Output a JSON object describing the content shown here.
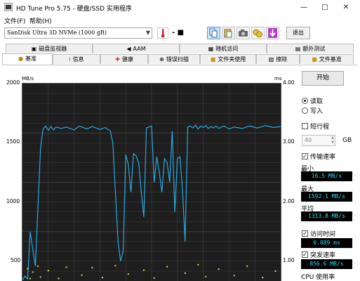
{
  "window": {
    "title": "HD Tune Pro 5.75 - 硬盘/SSD 实用程序",
    "minimize": "—",
    "maximize": "□",
    "close": "✕"
  },
  "menu": [
    "文件(F)",
    "帮助(H)"
  ],
  "toolbar": {
    "drive": "SanDisk Ultra 3D NVMe (1000 gB)",
    "temperature": "- ■",
    "exit_label": "退出",
    "icons": [
      "thermometer-icon",
      "copy-icon",
      "paste-icon",
      "camera-icon",
      "coins-icon",
      "download-icon"
    ]
  },
  "tabs_top": [
    {
      "label": "磁盘监视器",
      "icon": "monitor-icon"
    },
    {
      "label": "AAM",
      "icon": "speaker-icon"
    },
    {
      "label": "随机访问",
      "icon": "random-icon"
    },
    {
      "label": "额外测试",
      "icon": "extra-icon"
    }
  ],
  "tabs_bottom": [
    {
      "label": "基准",
      "icon": "benchmark-icon",
      "selected": true
    },
    {
      "label": "信息",
      "icon": "info-icon"
    },
    {
      "label": "健康",
      "icon": "health-icon"
    },
    {
      "label": "错误扫描",
      "icon": "scan-icon"
    },
    {
      "label": "文件夹使用",
      "icon": "folder-icon"
    },
    {
      "label": "擦除",
      "icon": "erase-icon"
    },
    {
      "label": "文件基准",
      "icon": "file-benchmark-icon"
    }
  ],
  "benchmark": {
    "start_label": "开始",
    "read_label": "读取",
    "write_label": "写入",
    "mode": "read",
    "short_stroke_label": "短行程",
    "short_stroke_checked": false,
    "short_stroke_value": "40",
    "short_stroke_unit": "GB",
    "transfer_rate_label": "传输速率",
    "transfer_rate_checked": true,
    "min_label": "最小",
    "min_value": "16.5 MB/s",
    "max_label": "最大",
    "max_value": "1592.1 MB/s",
    "avg_label": "平均",
    "avg_value": "1313.8 MB/s",
    "access_time_label": "访问时间",
    "access_time_checked": true,
    "access_time_value": "0.089 ms",
    "burst_label": "突发速率",
    "burst_checked": true,
    "burst_value": "856.6 MB/s",
    "cpu_label": "CPU 使用率"
  },
  "chart_data": {
    "type": "line",
    "y_left_unit": "MB/s",
    "y_right_unit": "ms",
    "ylim": [
      0,
      2000
    ],
    "y2lim": [
      0,
      4.0
    ],
    "yticks_left": [
      "2000",
      "1500",
      "1000",
      "500"
    ],
    "yticks_right": [
      "4.00",
      "3.00",
      "2.00",
      "1.00"
    ],
    "grid": true,
    "x": [
      0,
      1,
      2,
      3,
      5,
      7,
      8,
      9,
      10,
      11,
      12,
      13,
      15,
      17,
      20,
      22,
      25,
      27,
      30,
      32,
      34,
      35,
      36,
      37,
      38,
      39,
      40,
      41,
      42,
      43,
      44,
      45,
      46,
      47,
      48,
      49,
      50,
      51,
      52,
      53,
      54,
      55,
      56,
      57,
      58,
      59,
      60,
      61,
      62,
      63,
      64,
      65,
      66,
      67,
      68,
      69,
      70,
      71,
      72,
      73,
      74,
      75,
      76,
      77,
      78,
      80,
      82,
      85,
      88,
      91,
      94,
      97,
      100
    ],
    "y": [
      10,
      50,
      20,
      500,
      150,
      1350,
      1540,
      1570,
      1525,
      1565,
      1530,
      1560,
      1545,
      1560,
      1530,
      1570,
      1540,
      1565,
      1535,
      1555,
      1520,
      1400,
      900,
      400,
      200,
      300,
      1280,
      1180,
      900,
      1290,
      1270,
      1200,
      900,
      650,
      1550,
      1560,
      1570,
      1000,
      1260,
      1100,
      900,
      1240,
      1200,
      1000,
      1520,
      700,
      1240,
      1260,
      900,
      400,
      1560,
      1570,
      1550,
      1580,
      1540,
      1570,
      1555,
      1575,
      1545,
      1565,
      1550,
      1570,
      1545,
      1560,
      1570,
      1540,
      1560,
      1545,
      1570,
      1550,
      1575,
      1555,
      1565
    ],
    "y2_series": {
      "x": [
        2,
        3,
        4,
        6,
        7,
        10,
        14,
        17,
        23,
        27,
        31,
        36,
        41,
        47,
        51,
        56,
        63,
        68,
        71,
        76,
        82,
        87,
        93,
        98
      ],
      "y": [
        0.25,
        0.05,
        0.18,
        0.3,
        0.08,
        0.21,
        0.05,
        0.28,
        0.12,
        0.27,
        0.07,
        0.31,
        0.14,
        0.22,
        0.06,
        0.29,
        0.16,
        0.33,
        0.09,
        0.24,
        0.11,
        0.3,
        0.07,
        0.2
      ]
    }
  },
  "colors": {
    "chart_bg": "#1e1e1e",
    "grid": "#3f3f3f",
    "transfer_line": "#29a9e1",
    "access_points": "#e8d14a",
    "stat_text": "#2fd6f0"
  }
}
